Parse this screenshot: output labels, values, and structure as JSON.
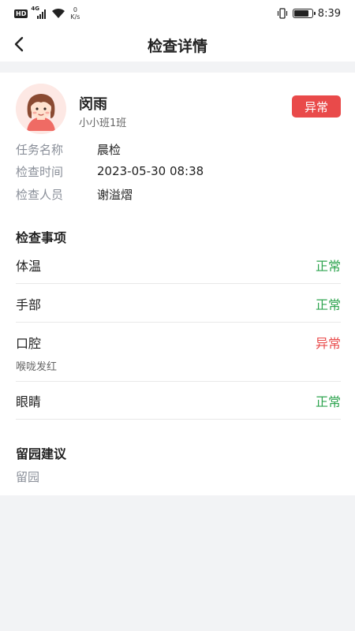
{
  "status_bar": {
    "hd": "HD",
    "network": "4G",
    "speed_value": "0",
    "speed_unit": "K/s",
    "time": "8:39",
    "battery_level": 0.85
  },
  "nav": {
    "title": "检查详情",
    "back_icon": "chevron-left-icon"
  },
  "student": {
    "name": "闵雨",
    "class": "小小班1班",
    "status": "异常",
    "status_color": "#e94a4a"
  },
  "info": [
    {
      "label": "任务名称",
      "value": "晨检"
    },
    {
      "label": "检查时间",
      "value": "2023-05-30 08:38"
    },
    {
      "label": "检查人员",
      "value": "谢溢熠"
    }
  ],
  "items_title": "检查事项",
  "items": [
    {
      "name": "体温",
      "result": "正常",
      "status": "ok",
      "note": ""
    },
    {
      "name": "手部",
      "result": "正常",
      "status": "ok",
      "note": ""
    },
    {
      "name": "口腔",
      "result": "异常",
      "status": "bad",
      "note": "喉咙发红"
    },
    {
      "name": "眼睛",
      "result": "正常",
      "status": "ok",
      "note": ""
    }
  ],
  "advice": {
    "title": "留园建议",
    "value": "留园"
  },
  "colors": {
    "normal": "#2ea44f",
    "abnormal": "#e94a4a"
  }
}
